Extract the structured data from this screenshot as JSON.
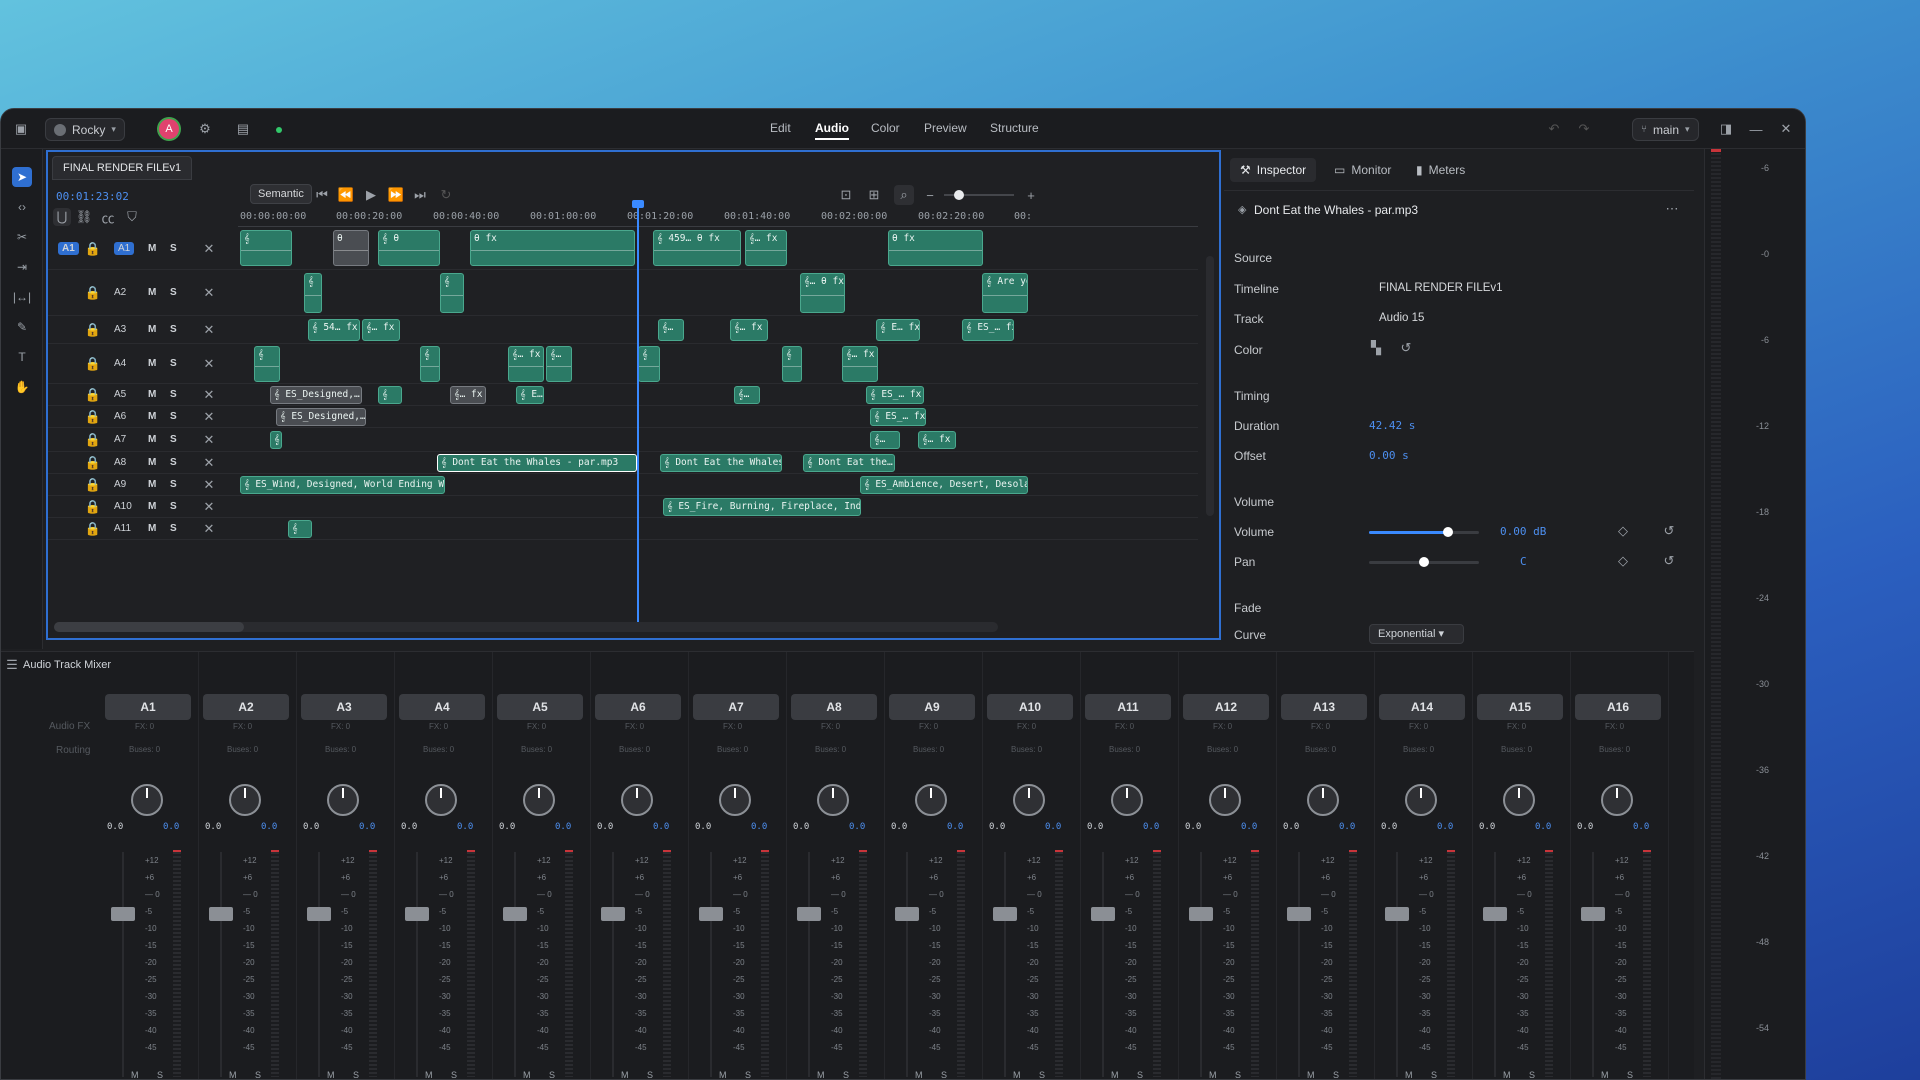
{
  "titlebar": {
    "workspace": "Rocky",
    "avatar": "A",
    "nav": [
      "Edit",
      "Audio",
      "Color",
      "Preview",
      "Structure"
    ],
    "active_nav": "Audio",
    "branch": "main"
  },
  "timeline": {
    "tab": "FINAL RENDER FILEv1",
    "timecode": "00:01:23:02",
    "mode": "Semantic",
    "ruler": [
      "00:00:00:00",
      "00:00:20:00",
      "00:00:40:00",
      "00:01:00:00",
      "00:01:20:00",
      "00:01:40:00",
      "00:02:00:00",
      "00:02:20:00",
      "00:"
    ],
    "tracks": [
      {
        "name": "A1",
        "clips": [
          "𝄞",
          "𝄞",
          "θ",
          "𝄞",
          "𝄞 θ",
          "𝄞",
          "θ fx",
          "θ",
          "𝄞",
          "θ",
          "𝄞",
          "θ fx",
          "𝄞 459… θ fx",
          "𝄞",
          "𝄞… fx",
          "𝄞",
          "θ fx"
        ]
      },
      {
        "name": "A2",
        "clips": [
          "𝄞",
          "𝄞",
          "𝄞… θ fx",
          "𝄞 Are you"
        ]
      },
      {
        "name": "A3",
        "clips": [
          "𝄞 54… fx",
          "𝄞… fx",
          "𝄞",
          "𝄞…",
          "𝄞… fx",
          "𝄞…",
          "𝄞 E… fx",
          "𝄞 ES_… fx"
        ]
      },
      {
        "name": "A4",
        "clips": [
          "𝄞",
          "𝄞",
          "𝄞… fx",
          "𝄞…",
          "𝄞",
          "𝄞",
          "𝄞… fx"
        ]
      },
      {
        "name": "A5",
        "clips": [
          "𝄞 ES_Designed,… fx",
          "𝄞",
          "𝄞… fx",
          "𝄞 E…",
          "𝄞…",
          "𝄞 ES_… fx"
        ]
      },
      {
        "name": "A6",
        "clips": [
          "𝄞 ES_Designed,… fx",
          "𝄞 ES_… fx"
        ]
      },
      {
        "name": "A7",
        "clips": [
          "𝄞",
          "𝄞…",
          "𝄞… fx"
        ]
      },
      {
        "name": "A8",
        "clips": [
          "𝄞 Dont Eat the Whales - par.mp3",
          "fx",
          "𝄞 Dont Eat the Whales… fx",
          "𝄞 Dont Eat the… fx"
        ]
      },
      {
        "name": "A9",
        "clips": [
          "𝄞 ES_Wind, Designed, World Ending Wind -… fx",
          "𝄞 ES_Ambience, Desert, Desolation, C"
        ]
      },
      {
        "name": "A10",
        "clips": [
          "𝄞 ES_Fire, Burning, Fireplace, Indoor,… fx"
        ]
      },
      {
        "name": "A11",
        "clips": [
          "𝄞"
        ]
      }
    ]
  },
  "inspector": {
    "tabs": [
      "Inspector",
      "Monitor",
      "Meters"
    ],
    "clip_title": "Dont Eat the Whales - par.mp3",
    "source_label": "Source",
    "timeline_label": "Timeline",
    "timeline_value": "FINAL RENDER FILEv1",
    "track_label": "Track",
    "track_value": "Audio 15",
    "color_label": "Color",
    "timing_label": "Timing",
    "duration_label": "Duration",
    "duration_value": "42.42 s",
    "offset_label": "Offset",
    "offset_value": "0.00 s",
    "volume_section": "Volume",
    "volume_label": "Volume",
    "volume_value": "0.00 dB",
    "volume_level": 0.72,
    "pan_label": "Pan",
    "pan_value": "C",
    "fade_label": "Fade",
    "curve_label": "Curve",
    "curve_value": "Exponential"
  },
  "meters": [
    "-6",
    "-0",
    "-6",
    "-12",
    "-18",
    "-24",
    "-30",
    "-36",
    "-42",
    "-48",
    "-54"
  ],
  "mixer": {
    "title": "Audio Track Mixer",
    "audio_fx_label": "Audio FX",
    "routing_label": "Routing",
    "fx_text": "FX: 0",
    "buses_text": "Buses: 0",
    "gain": "0.0",
    "pan": "0.0",
    "fader_zero": "— 0",
    "scale": [
      "+12",
      "+6",
      "— 0",
      "-5",
      "-10",
      "-15",
      "-20",
      "-25",
      "-30",
      "-35",
      "-40",
      "-45"
    ],
    "channels": [
      "A1",
      "A2",
      "A3",
      "A4",
      "A5",
      "A6",
      "A7",
      "A8",
      "A9",
      "A10",
      "A11",
      "A12",
      "A13",
      "A14",
      "A15",
      "A16"
    ],
    "m_label": "M",
    "s_label": "S"
  },
  "colors": {
    "accent": "#2f6fd1",
    "clip": "#2b7a66",
    "playhead": "#3a8aff"
  }
}
